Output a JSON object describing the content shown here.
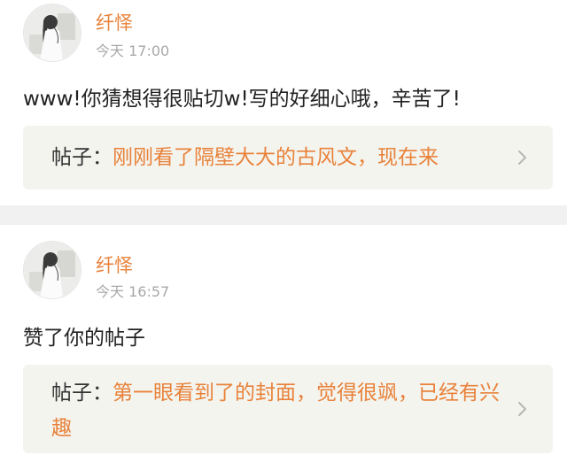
{
  "notifications": [
    {
      "username": "纤怿",
      "timestamp": "今天 17:00",
      "comment": "www!你猜想得很贴切w!写的好细心哦，辛苦了!",
      "post_prefix": "帖子：",
      "post_title": "刚刚看了隔壁大大的古风文，现在来"
    },
    {
      "username": "纤怿",
      "timestamp": "今天 16:57",
      "comment": "赞了你的帖子",
      "post_prefix": "帖子：",
      "post_title": "第一眼看到了的封面，觉得很飒，已经有兴趣"
    }
  ],
  "colors": {
    "accent": "#e8823a",
    "timestamp": "#a8a8a8",
    "post_box_bg": "#f4f4ef",
    "divider": "#f1f1f1"
  },
  "icons": {
    "avatar": "avatar-image",
    "chevron": "chevron-right-icon"
  }
}
